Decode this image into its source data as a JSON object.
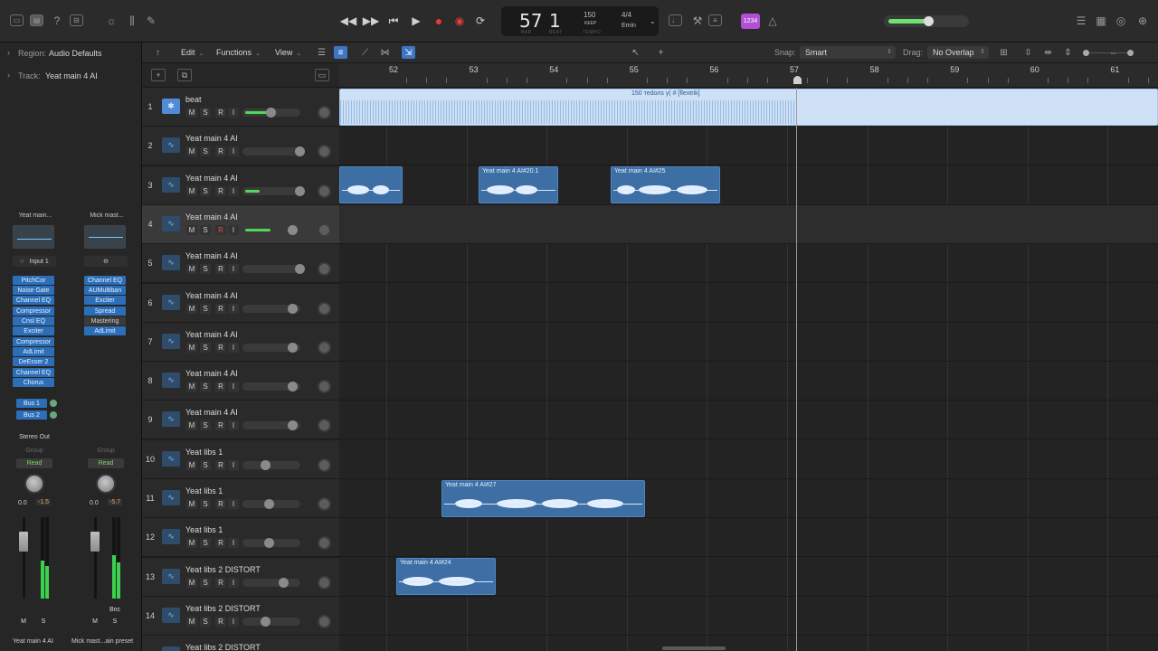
{
  "transport": {
    "bar": "57",
    "beat": "1",
    "bar_label": "BAR",
    "beat_label": "BEAT",
    "tempo": "150",
    "tempo_mode": "KEEP",
    "tempo_label": "TEMPO",
    "time_sig": "4/4",
    "key": "Emin",
    "count_in": "1234"
  },
  "inspector": {
    "region_label": "Region:",
    "region_value": "Audio Defaults",
    "track_label": "Track:",
    "track_value": "Yeat main 4 AI",
    "strips": [
      {
        "name": "Yeat main...",
        "input": "Input 1",
        "plugins": [
          "PitchCor",
          "Noise Gate",
          "Channel EQ",
          "Compressor",
          "Cnsl EQ",
          "Exciter",
          "Compressor",
          "AdLimit",
          "DeEsser 2",
          "Channel EQ",
          "Chorus"
        ],
        "sends": [
          "Bus 1",
          "Bus 2"
        ],
        "output": "Stereo Out",
        "group": "Group",
        "automation": "Read",
        "volume": "0.0",
        "peak": "-1.5",
        "mute": "M",
        "solo": "S",
        "footer": "Yeat main 4 AI"
      },
      {
        "name": "Mick mast...",
        "input": "",
        "plugins": [
          "Channel EQ",
          "AUMultiban",
          "Exciter",
          "Spread",
          "Mastering",
          "AdLimit"
        ],
        "sends": [],
        "output": "",
        "group": "Group",
        "automation": "Read",
        "volume": "0.0",
        "peak": "-5.7",
        "bounce": "Bnc",
        "mute": "M",
        "solo": "S",
        "footer": "Mick mast...ain preset"
      }
    ]
  },
  "toolbar": {
    "edit": "Edit",
    "functions": "Functions",
    "view": "View",
    "snap_label": "Snap:",
    "snap_value": "Smart",
    "drag_label": "Drag:",
    "drag_value": "No Overlap"
  },
  "ruler": {
    "bars": [
      "52",
      "53",
      "54",
      "55",
      "56",
      "57",
      "58",
      "59",
      "60",
      "61"
    ]
  },
  "track_buttons": {
    "mute": "M",
    "solo": "S",
    "rec": "R",
    "input": "I"
  },
  "tracks": [
    {
      "num": "1",
      "name": "beat"
    },
    {
      "num": "2",
      "name": "Yeat main 4 AI"
    },
    {
      "num": "3",
      "name": "Yeat main 4 AI"
    },
    {
      "num": "4",
      "name": "Yeat main 4 AI"
    },
    {
      "num": "5",
      "name": "Yeat main 4 AI"
    },
    {
      "num": "6",
      "name": "Yeat main 4 AI"
    },
    {
      "num": "7",
      "name": "Yeat main 4 AI"
    },
    {
      "num": "8",
      "name": "Yeat main 4 AI"
    },
    {
      "num": "9",
      "name": "Yeat main 4 AI"
    },
    {
      "num": "10",
      "name": "Yeat libs 1"
    },
    {
      "num": "11",
      "name": "Yeat libs 1"
    },
    {
      "num": "12",
      "name": "Yeat libs 1"
    },
    {
      "num": "13",
      "name": "Yeat libs 2 DISTORT"
    },
    {
      "num": "14",
      "name": "Yeat libs 2 DISTORT"
    },
    {
      "num": "15",
      "name": "Yeat libs 2 DISTORT"
    }
  ],
  "regions": {
    "beat": "150 теdолѕ у( # [flextrik]",
    "r3a": "",
    "r3b": "Yeat main 4 AI#20.1",
    "r3c": "Yeat main 4 AI#25",
    "r11": "Yeat main 4 AI#27",
    "r13": "Yeat main 4 AI#24"
  }
}
